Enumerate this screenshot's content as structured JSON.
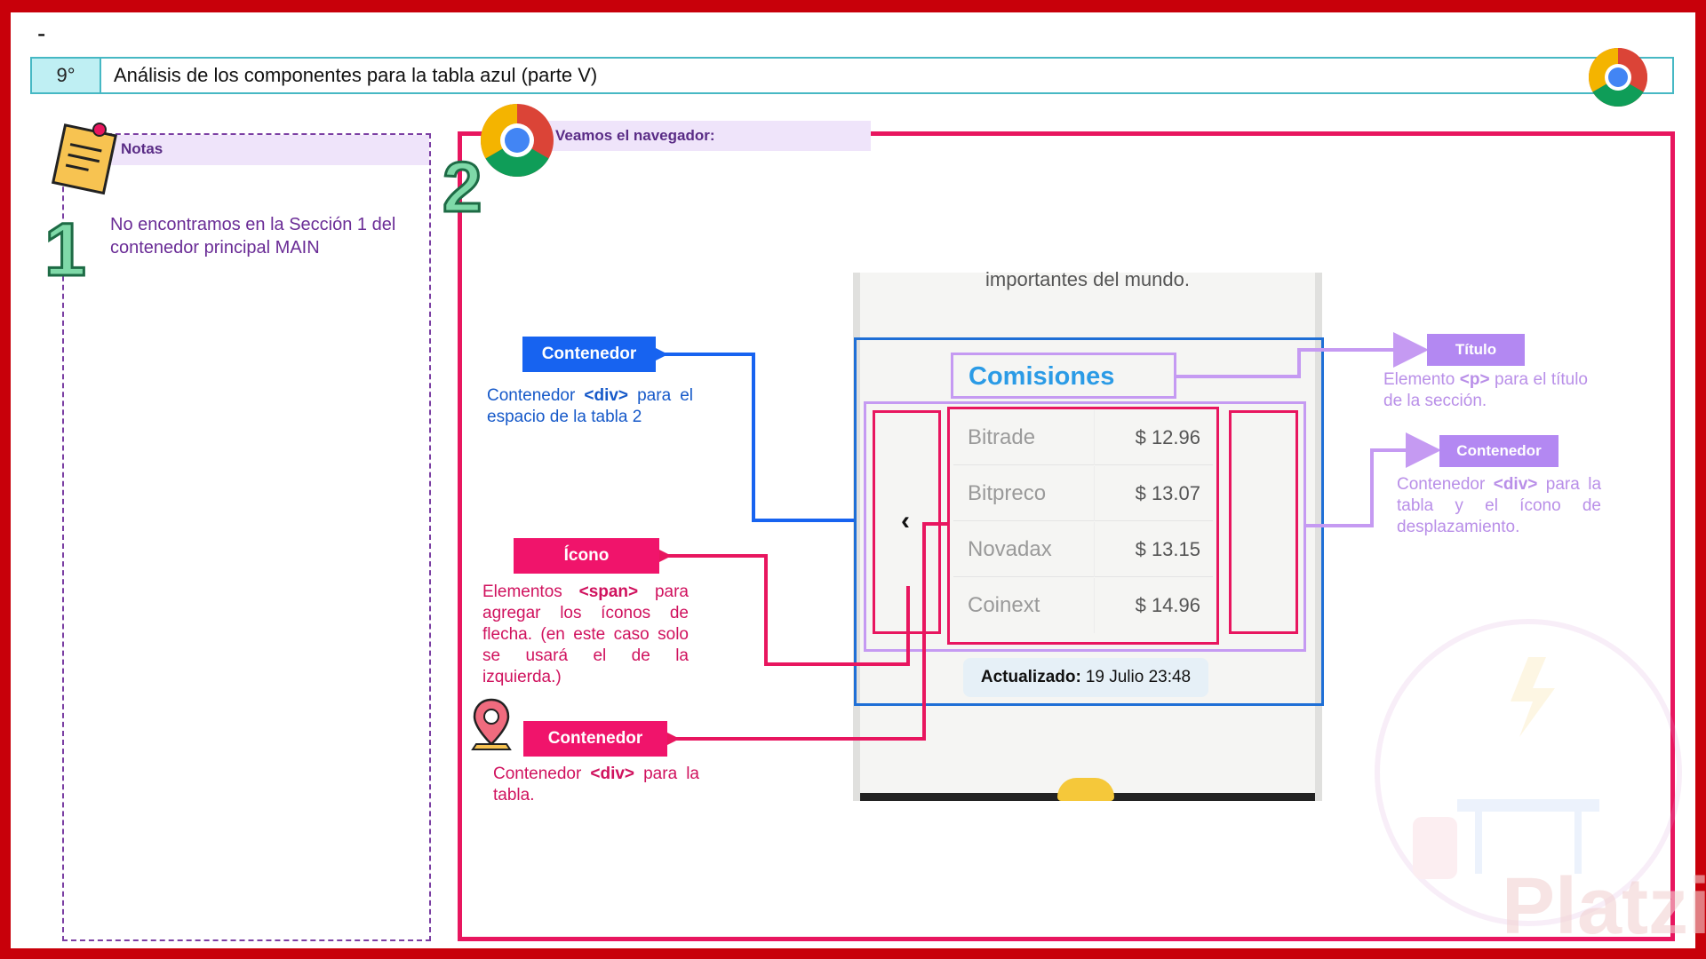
{
  "header": {
    "dash": "-",
    "number": "9°",
    "title": "Análisis de los componentes para la tabla azul (parte V)"
  },
  "notes": {
    "label": "Notas",
    "step": "1",
    "text": "No encontramos en la Sección 1 del contenedor principal MAIN"
  },
  "browser": {
    "label": "Veamos el navegador:",
    "step": "2"
  },
  "phone": {
    "top_text": "importantes del mundo.",
    "section_title": "Comisiones",
    "chevron": "‹",
    "rows": [
      {
        "name": "Bitrade",
        "value": "$ 12.96"
      },
      {
        "name": "Bitpreco",
        "value": "$ 13.07"
      },
      {
        "name": "Novadax",
        "value": "$ 13.15"
      },
      {
        "name": "Coinext",
        "value": "$ 14.96"
      }
    ],
    "updated_label": "Actualizado:",
    "updated_value": "19 Julio 23:48"
  },
  "annotations": {
    "contenedor_blue": {
      "tag": "Contenedor",
      "desc": "Contenedor <div> para el espacio de la tabla 2"
    },
    "icono": {
      "tag": "Ícono",
      "desc": "Elementos <span> para agregar los íconos de flecha. (en este caso solo se usará el de la izquierda.)"
    },
    "contenedor_table": {
      "tag": "Contenedor",
      "desc": "Contenedor <div> para la tabla."
    },
    "titulo": {
      "tag": "Título",
      "desc": "Elemento <p> para el título de la sección."
    },
    "contenedor_purple": {
      "tag": "Contenedor",
      "desc": "Contenedor <div> para la tabla y el ícono de desplazamiento."
    }
  },
  "watermark": {
    "text": "Platzi"
  },
  "colors": {
    "frame": "#c8000a",
    "pink": "#e8165f",
    "blue": "#1f6fd6",
    "purple": "#c59af2",
    "teal": "#46b8c4"
  }
}
